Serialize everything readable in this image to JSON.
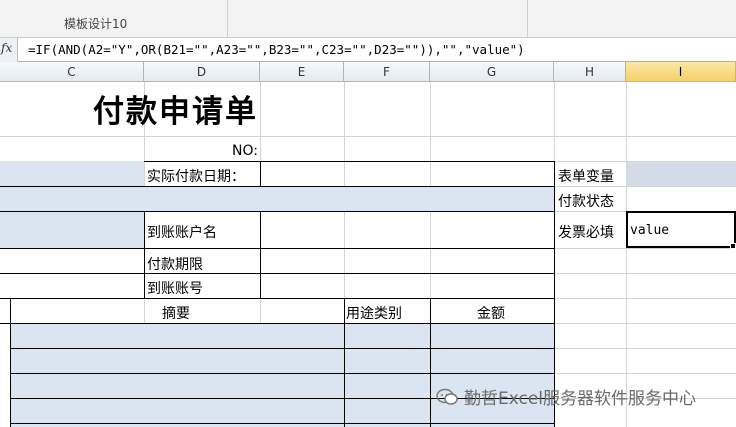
{
  "ribbon": {
    "label": "模板设计10"
  },
  "formula_bar": {
    "fx": "fx",
    "formula": "=IF(AND(A2=\"Y\",OR(B21=\"\",A23=\"\",B23=\"\",C23=\"\",D23=\"\")),\"\",\"value\")"
  },
  "columns": [
    "C",
    "D",
    "E",
    "F",
    "G",
    "H",
    "I"
  ],
  "sheet": {
    "title": "付款申请单",
    "no_label": "NO:",
    "actual_pay_date": "实际付款日期：",
    "account_name": "到账账户名",
    "pay_term": "付款期限",
    "account_no": "到账账号",
    "summary_header": "摘要",
    "category_header": "用途类别",
    "amount_header": "金额",
    "form_var": "表单变量",
    "pay_status": "付款状态",
    "invoice_required": "发票必填",
    "selected_value": "value"
  },
  "watermark": {
    "text": "勤哲Excel服务器软件服务中心"
  },
  "colors": {
    "fill": "#dbe5f1",
    "selected_header": "#f6d16a"
  }
}
